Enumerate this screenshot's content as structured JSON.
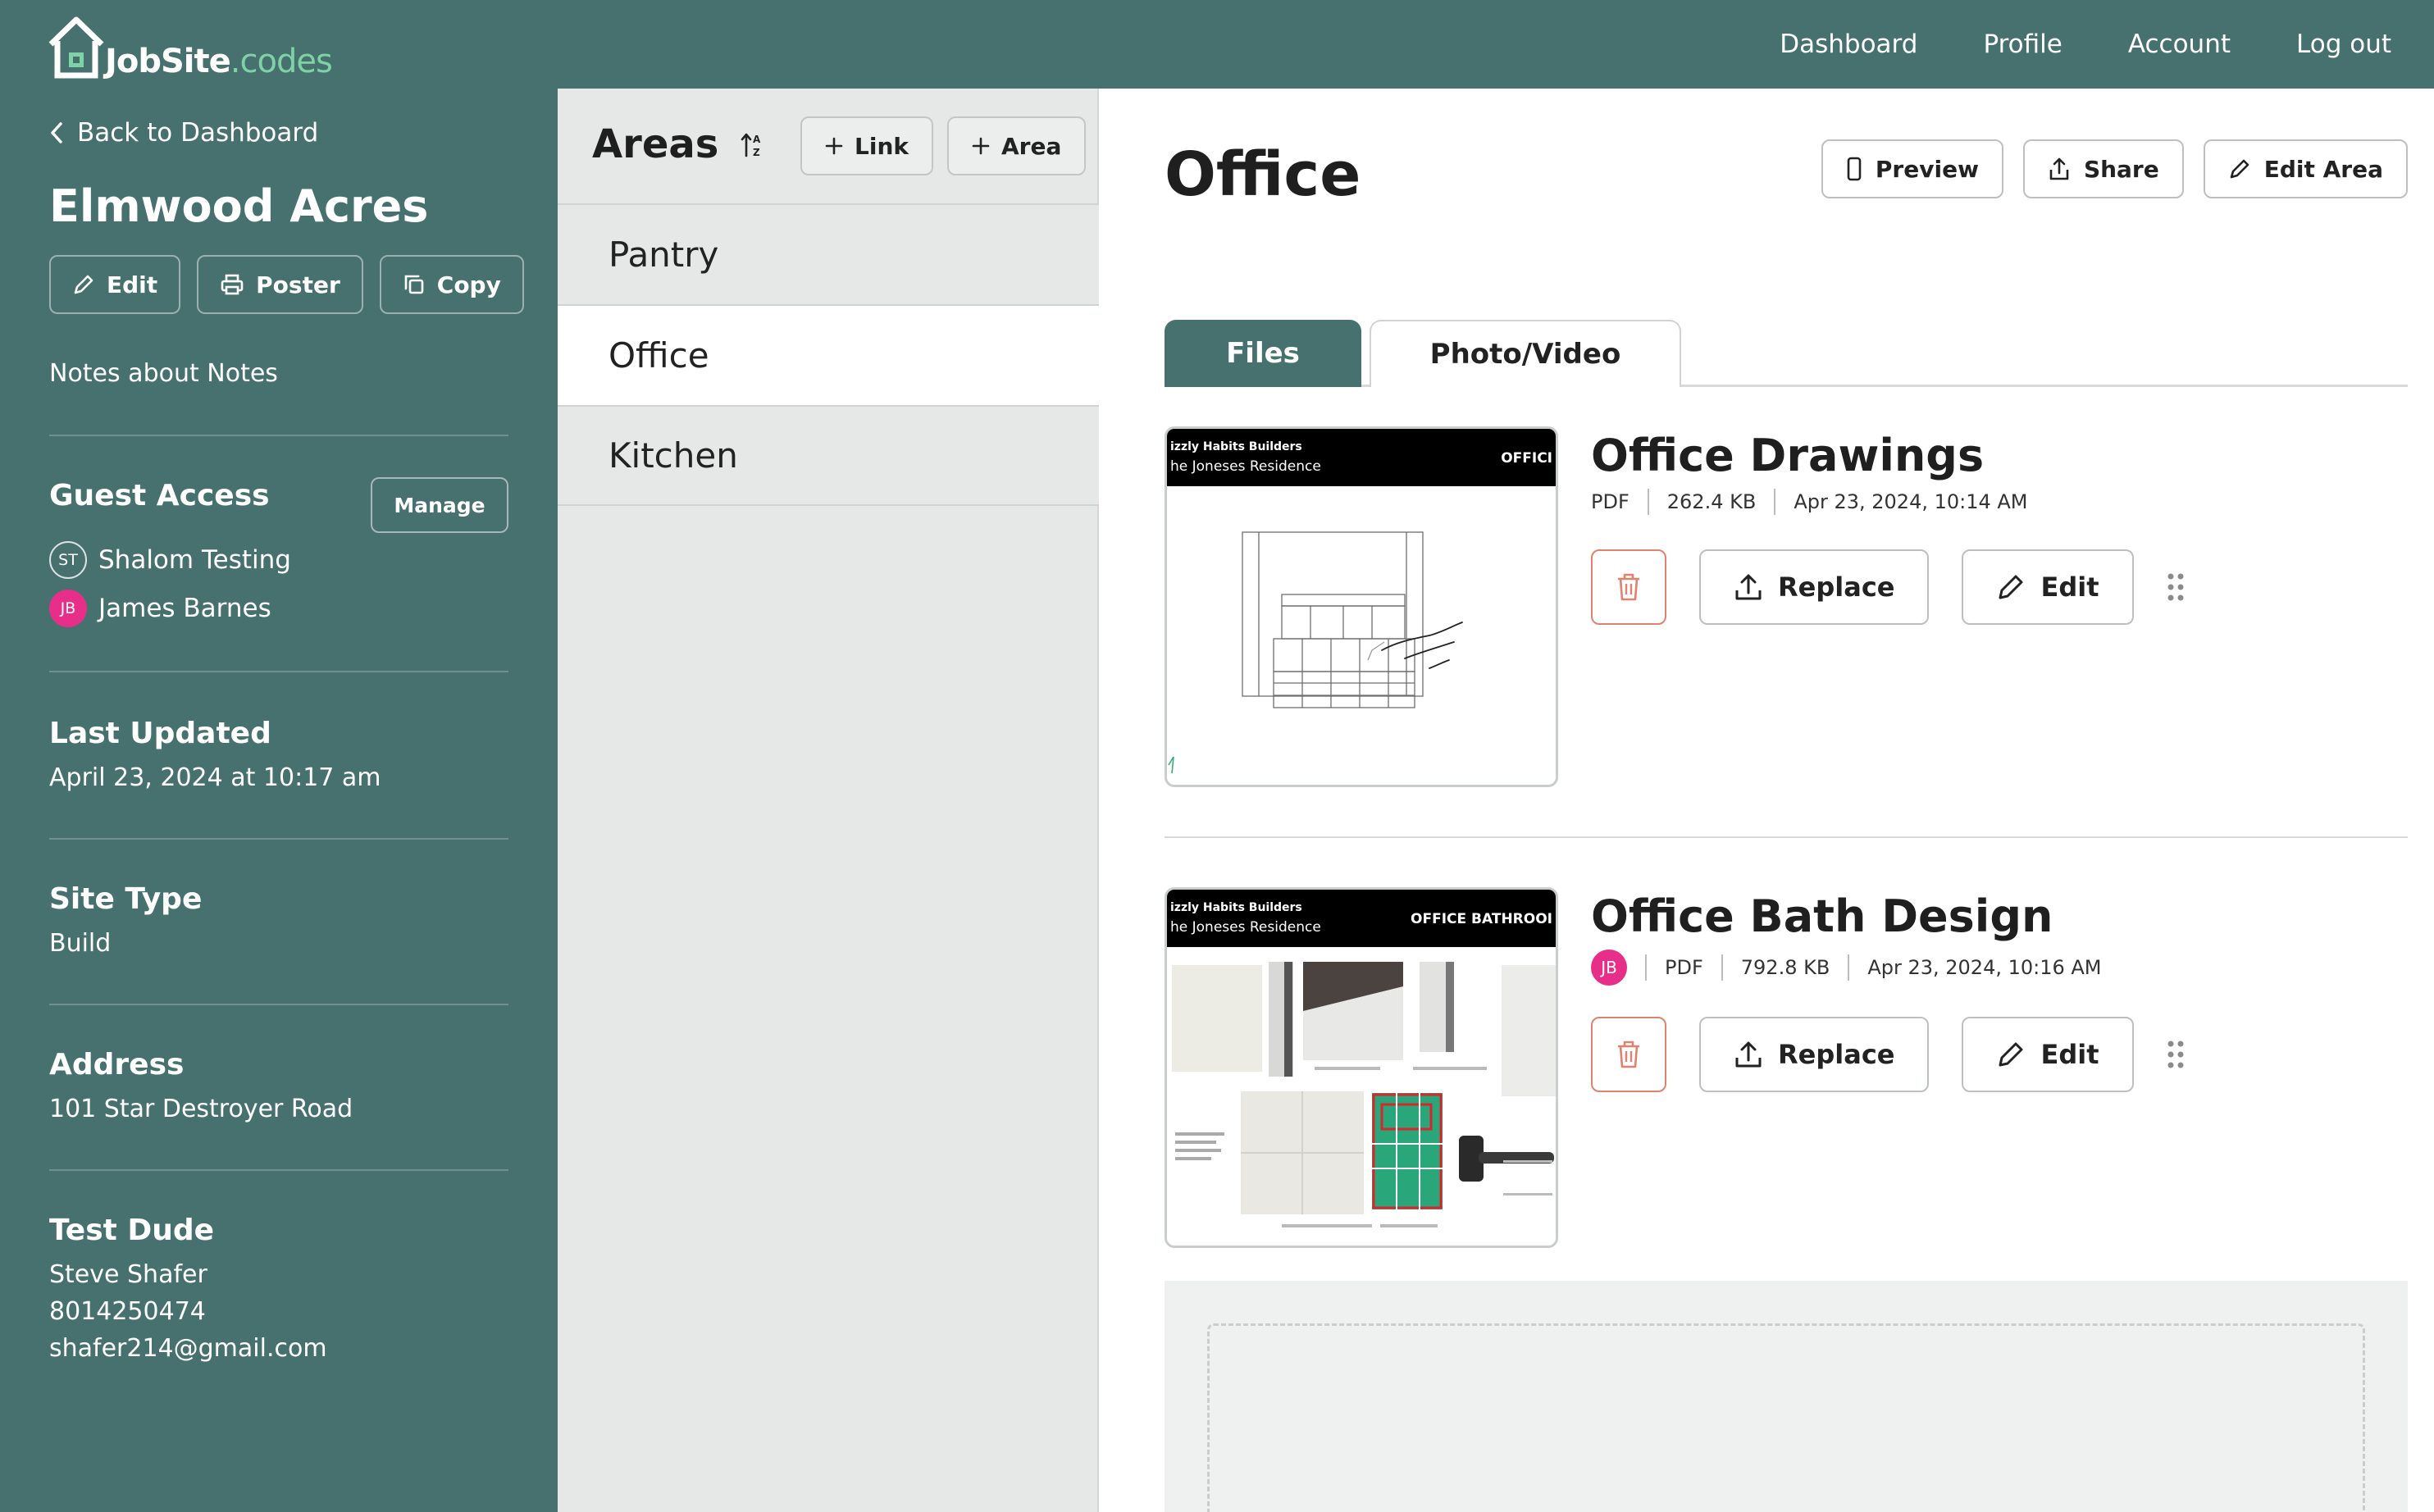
{
  "brand": {
    "name_bold": "JobSite",
    "name_light": ".codes"
  },
  "nav": {
    "items": [
      "Dashboard",
      "Profile",
      "Account",
      "Log out"
    ]
  },
  "sidebar": {
    "back_label": "Back to Dashboard",
    "project_title": "Elmwood Acres",
    "buttons": {
      "edit": "Edit",
      "poster": "Poster",
      "copy": "Copy"
    },
    "notes": "Notes about Notes",
    "guest_access": {
      "title": "Guest Access",
      "manage_label": "Manage",
      "guests": [
        {
          "initials": "ST",
          "name": "Shalom Testing"
        },
        {
          "initials": "JB",
          "name": "James Barnes"
        }
      ]
    },
    "last_updated": {
      "title": "Last Updated",
      "value": "April 23, 2024 at 10:17 am"
    },
    "site_type": {
      "title": "Site Type",
      "value": "Build"
    },
    "address": {
      "title": "Address",
      "value": "101 Star Destroyer Road"
    },
    "contact": {
      "title": "Test Dude",
      "name": "Steve Shafer",
      "phone": "8014250474",
      "email": "shafer214@gmail.com"
    }
  },
  "areas": {
    "title": "Areas",
    "link_label": "Link",
    "area_label": "Area",
    "items": [
      "Pantry",
      "Office",
      "Kitchen"
    ],
    "active": "Office"
  },
  "main": {
    "title": "Office",
    "actions": {
      "preview": "Preview",
      "share": "Share",
      "edit_area": "Edit Area"
    },
    "tabs": [
      "Files",
      "Photo/Video"
    ],
    "files": [
      {
        "name": "Office Drawings",
        "type": "PDF",
        "size": "262.4 KB",
        "date": "Apr 23, 2024, 10:14 AM",
        "thumb": {
          "company": "izzly Habits Builders",
          "residence": "he Joneses Residence",
          "tag": "OFFICI"
        }
      },
      {
        "name": "Office Bath Design",
        "uploader_initials": "JB",
        "type": "PDF",
        "size": "792.8 KB",
        "date": "Apr 23, 2024, 10:16 AM",
        "thumb": {
          "company": "izzly Habits Builders",
          "residence": "he Joneses Residence",
          "tag": "OFFICE BATHROOI"
        }
      }
    ],
    "file_actions": {
      "replace": "Replace",
      "edit": "Edit"
    }
  },
  "colors": {
    "brand_teal": "#47716f",
    "accent_green": "#7fd1a6",
    "delete_red": "#e0826e",
    "avatar_pink": "#e72f8a"
  }
}
